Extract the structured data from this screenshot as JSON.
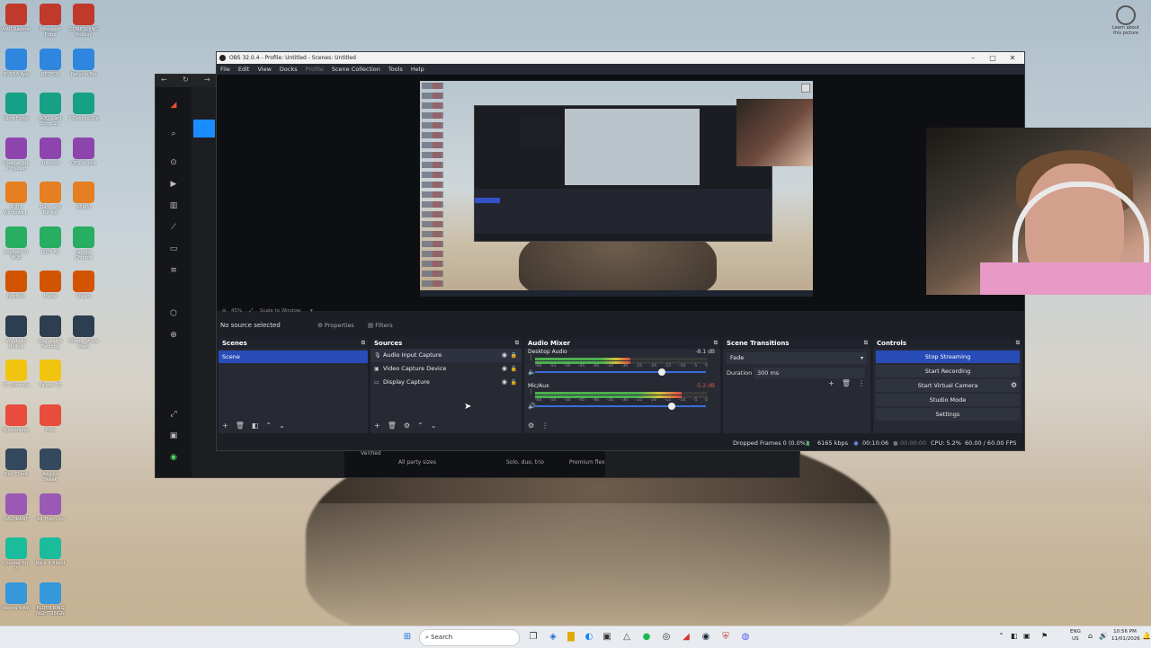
{
  "obs": {
    "title": "OBS 32.0.4 - Profile: Untitled - Scenes: Untitled",
    "menu": [
      "File",
      "Edit",
      "View",
      "Docks",
      "Profile",
      "Scene Collection",
      "Tools",
      "Help"
    ],
    "preview_zoom": "45%",
    "preview_scale_mode": "Scale to Window",
    "no_source": "No source selected",
    "properties_label": "Properties",
    "filters_label": "Filters",
    "scenes": {
      "title": "Scenes",
      "items": [
        "Scene"
      ]
    },
    "sources": {
      "title": "Sources",
      "items": [
        "Audio Input Capture",
        "Video Capture Device",
        "Display Capture"
      ]
    },
    "mixer": {
      "title": "Audio Mixer",
      "channels": [
        {
          "name": "Desktop Audio",
          "db": "-8.1 dB",
          "level": 0.55,
          "volume": 0.72
        },
        {
          "name": "Mic/Aux",
          "db": "-5.2 dB",
          "level": 0.85,
          "volume": 0.78
        }
      ],
      "ticks": [
        "-60",
        "-55",
        "-50",
        "-45",
        "-40",
        "-35",
        "-30",
        "-25",
        "-20",
        "-15",
        "-10",
        "-5",
        "0"
      ]
    },
    "transitions": {
      "title": "Scene Transitions",
      "selected": "Fade",
      "duration_label": "Duration",
      "duration": "300 ms"
    },
    "controls": {
      "title": "Controls",
      "stop_streaming": "Stop Streaming",
      "start_recording": "Start Recording",
      "start_virtual_camera": "Start Virtual Camera",
      "studio_mode": "Studio Mode",
      "settings": "Settings"
    },
    "stats": {
      "dropped_frames": "Dropped Frames 0 (0.0%)",
      "bitrate": "6165 kbps",
      "stream_time": "00:10:06",
      "rec_time": "00:00:00",
      "cpu": "CPU: 5.2%",
      "fps": "60.00 / 60.00 FPS"
    }
  },
  "bgapp": {
    "cards": [
      "All party sizes",
      "Solo, duo, trio",
      "Premium flex"
    ],
    "verified": "Verified"
  },
  "desktop": {
    "icons_col1": [
      "AMD Radeon",
      "NVIDIA App",
      "Glow Forge",
      "Counter-Str. 2 Tracker",
      "ASUS Windows L.",
      "Logitech G HUB",
      "Bopfolio",
      "Windows Hollow",
      "PC Shortcut",
      "Bookshelve",
      "Riot Client",
      "VALORANT",
      "Counter-Str. 2",
      "Wanna WAW"
    ],
    "icons_col2": [
      "Microsoft Edge",
      "REDFOX",
      "ROG Card Shop Si..",
      "Discord",
      "Dark and Darker",
      "RIOT AC",
      "Medal",
      "Overwatch Pending",
      "Fallout 76",
      "Rust",
      "Add-on Tweak",
      "All Them Vs",
      "Back 4 Blood",
      "ELDEN RING NIGHTREIGN"
    ],
    "icons_col3": [
      "GONE SHING Holiday",
      "Recycle Bin",
      "7 Days to Die",
      "OBS Studio",
      "R6RWI",
      "Google Chrome",
      "Steam",
      "Where Winds Meet"
    ],
    "widget": "Learn about this picture"
  },
  "taskbar": {
    "search_placeholder": "Search",
    "lang": "ENG",
    "region": "US",
    "time": "10:56 PM",
    "date": "11/01/2026"
  },
  "colors": {
    "accent": "#284cb8",
    "dock_bg": "#272a33",
    "window_bg": "#1d1f26"
  }
}
